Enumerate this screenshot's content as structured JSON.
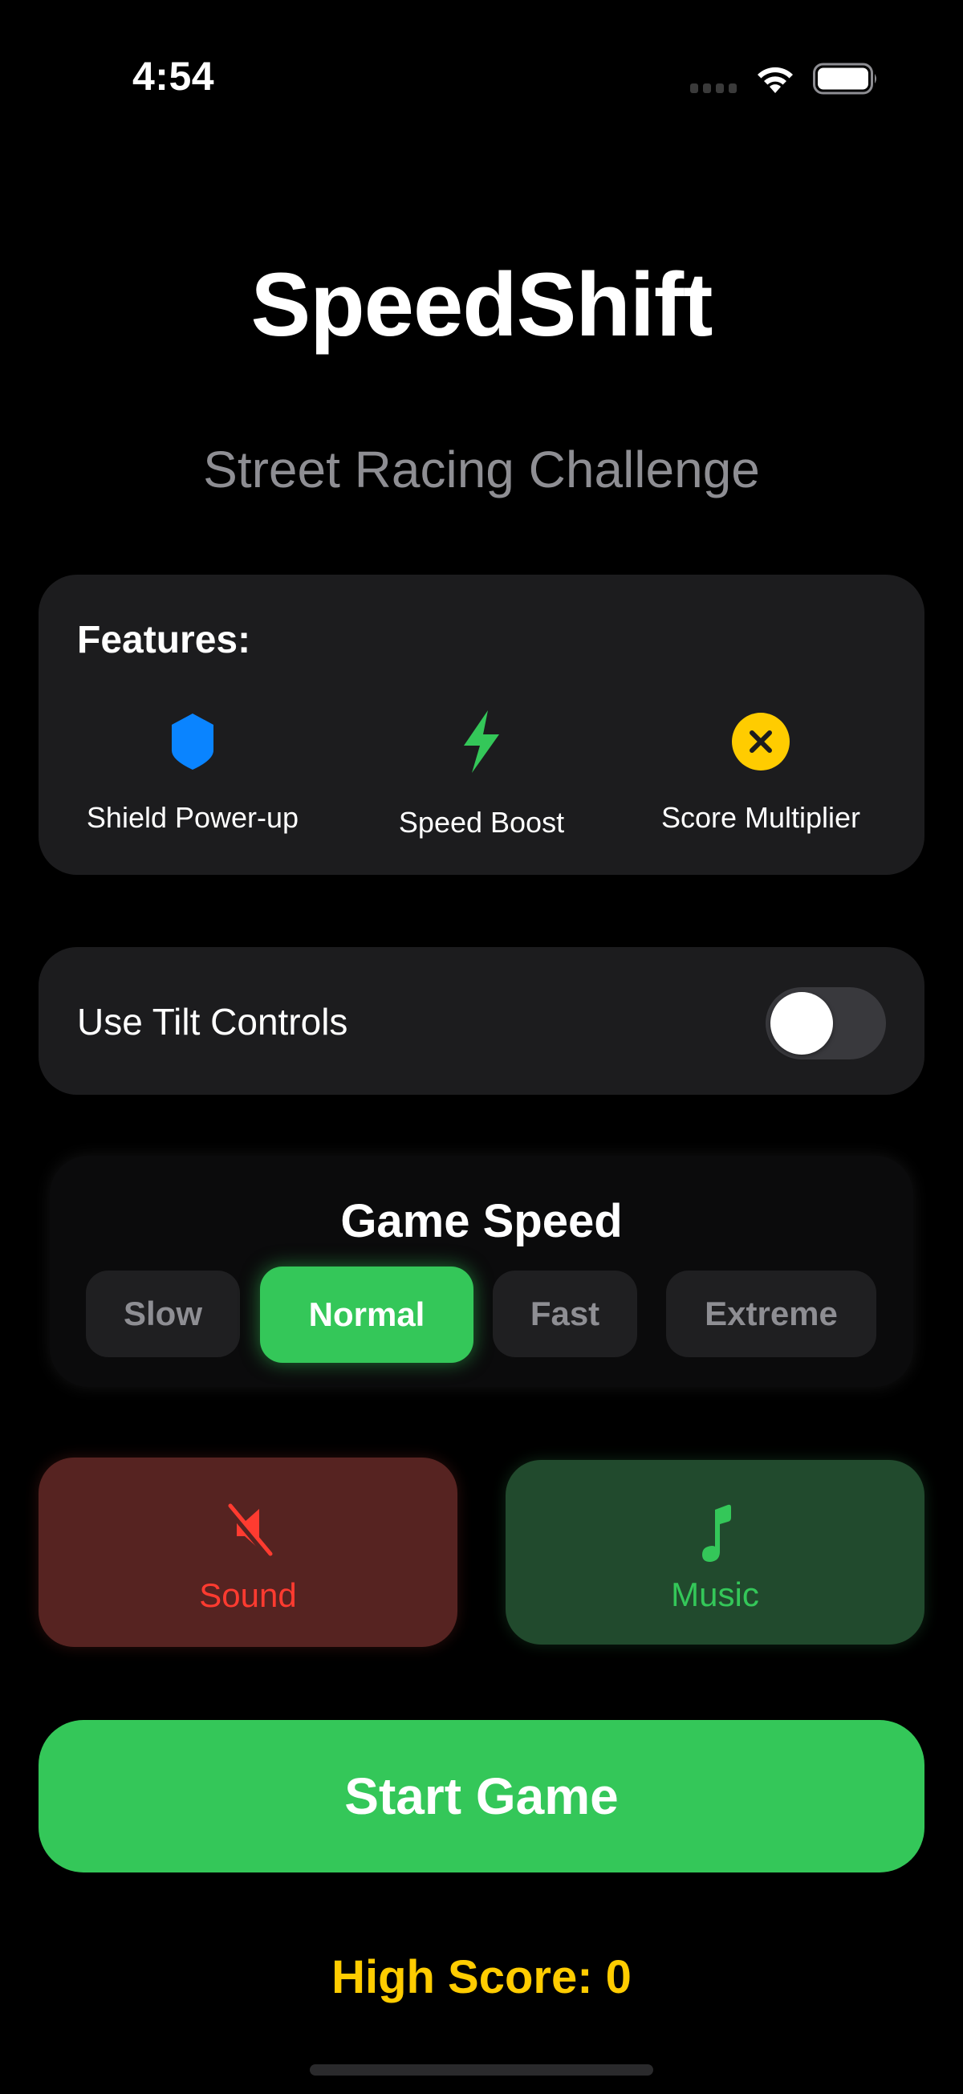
{
  "status_bar": {
    "time": "4:54",
    "icons": [
      "cellular-signal-icon",
      "wifi-icon",
      "battery-icon"
    ]
  },
  "header": {
    "title": "SpeedShift",
    "subtitle": "Street Racing Challenge"
  },
  "features": {
    "title": "Features:",
    "items": [
      {
        "label": "Shield Power-up",
        "icon": "shield-icon",
        "color": "#0a84ff"
      },
      {
        "label": "Speed Boost",
        "icon": "bolt-icon",
        "color": "#34c759"
      },
      {
        "label": "Score Multiplier",
        "icon": "xmark-circle-icon",
        "color": "#ffcc00"
      }
    ]
  },
  "tilt_controls": {
    "label": "Use Tilt Controls",
    "enabled": false
  },
  "game_speed": {
    "title": "Game Speed",
    "options": [
      "Slow",
      "Normal",
      "Fast",
      "Extreme"
    ],
    "selected": "Normal"
  },
  "audio": {
    "sound": {
      "label": "Sound",
      "icon": "speaker-muted-icon",
      "enabled": false,
      "color": "#ff3b30"
    },
    "music": {
      "label": "Music",
      "icon": "music-note-icon",
      "enabled": true,
      "color": "#34c759"
    }
  },
  "start_button": {
    "label": "Start Game"
  },
  "high_score": {
    "text": "High Score: 0",
    "value": 0
  },
  "colors": {
    "accent_green": "#34c759",
    "accent_red": "#ff3b30",
    "accent_yellow": "#ffcc00",
    "accent_blue": "#0a84ff",
    "card_bg": "#1c1c1e",
    "secondary_text": "#8e8e93"
  }
}
